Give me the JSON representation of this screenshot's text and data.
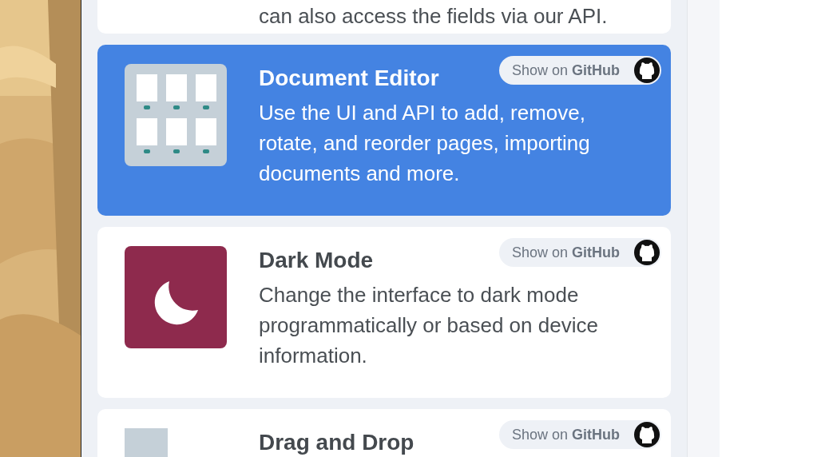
{
  "top_card": {
    "description_end": "can also access the fields via our API."
  },
  "cards": [
    {
      "title": "Document Editor",
      "description": "Use the UI and API to add, remove, rotate, and reorder pages, importing documents and more.",
      "selected": true,
      "kind": "pages",
      "github_button": "Show on **GitHub**"
    },
    {
      "title": "Dark Mode",
      "description": "Change the interface to dark mode programmatically or based on device information.",
      "selected": false,
      "kind": "moon",
      "github_button": "Show on **GitHub**"
    },
    {
      "title": "Drag and Drop",
      "selected": false,
      "kind": "blank",
      "github_button": "Show on **GitHub**"
    }
  ]
}
